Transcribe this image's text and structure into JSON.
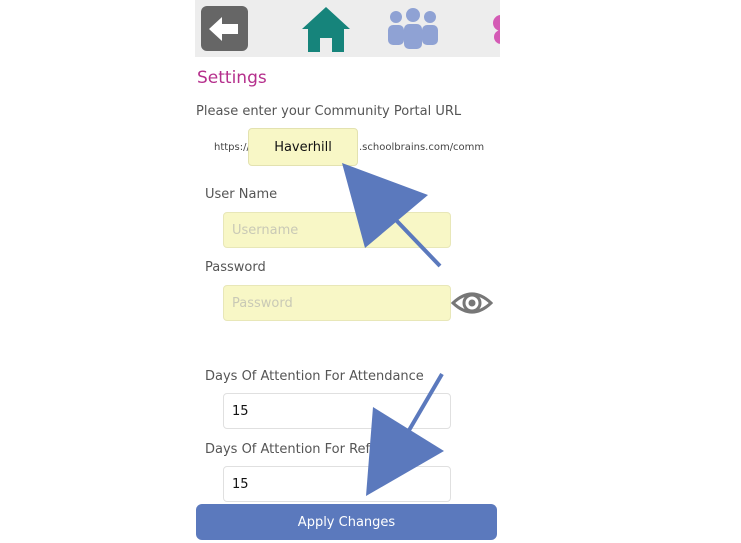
{
  "toolbar": {
    "back_icon": "back-arrow-icon",
    "home_icon": "home-icon",
    "people_icon": "group-icon",
    "accent_color": "#16847b"
  },
  "settings": {
    "title": "Settings",
    "portal_prompt": "Please enter your Community Portal URL",
    "url_prefix": "https://",
    "portal_value": "Haverhill",
    "url_suffix": ".schoolbrains.com/comm",
    "username_label": "User Name",
    "username_placeholder": "Username",
    "password_label": "Password",
    "password_placeholder": "Password",
    "attendance_label": "Days Of Attention For Attendance",
    "attendance_value": "15",
    "referrals_label": "Days Of Attention For Refer",
    "referrals_value": "15",
    "apply_label": "Apply Changes"
  },
  "colors": {
    "title": "#b52f8c",
    "button": "#5b79bd",
    "highlight_field": "#f8f7c6",
    "annotation_arrow": "#5b79bd"
  }
}
